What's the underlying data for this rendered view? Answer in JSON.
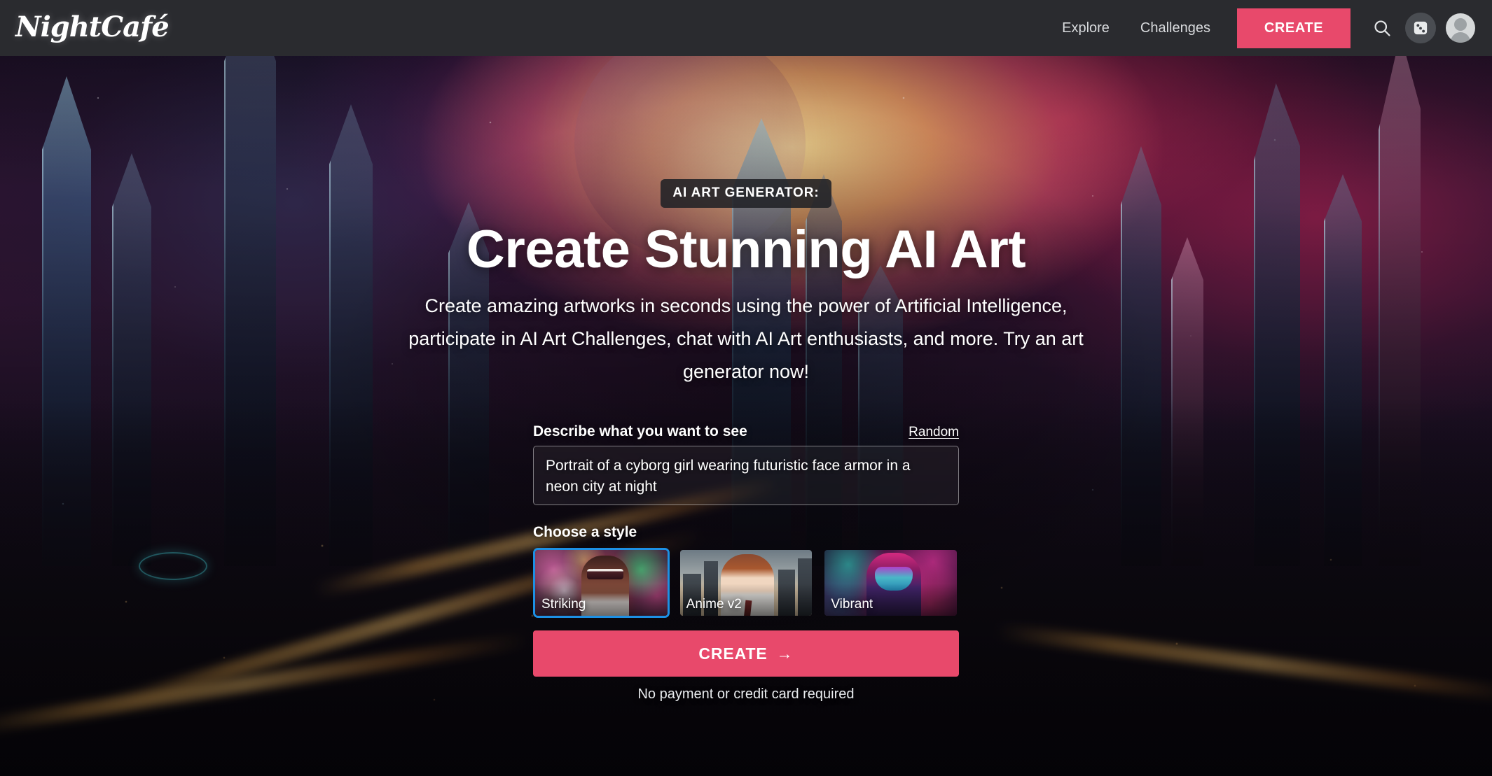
{
  "header": {
    "logo_text": "NightCafé",
    "nav_links": [
      {
        "label": "Explore"
      },
      {
        "label": "Challenges"
      }
    ],
    "create_button_label": "CREATE",
    "icons": {
      "search": "search-icon",
      "dice": "dice-icon",
      "avatar": "avatar-icon"
    }
  },
  "hero": {
    "eyebrow": "AI ART GENERATOR:",
    "headline": "Create Stunning AI Art",
    "subheadline": "Create amazing artworks in seconds using the power of Artificial Intelligence, participate in AI Art Challenges, chat with AI Art enthusiasts, and more. Try an art generator now!"
  },
  "form": {
    "prompt_label": "Describe what you want to see",
    "random_link": "Random",
    "prompt_value": "Portrait of a cyborg girl wearing futuristic face armor in a neon city at night",
    "prompt_placeholder": "Describe what you want to see",
    "style_label": "Choose a style",
    "styles": [
      {
        "name": "Striking",
        "selected": true
      },
      {
        "name": "Anime v2",
        "selected": false
      },
      {
        "name": "Vibrant",
        "selected": false
      }
    ],
    "submit_label": "CREATE",
    "submit_arrow": "→",
    "footnote": "No payment or credit card required"
  },
  "colors": {
    "accent_pink": "#e8496b",
    "header_bg": "#2a2b2f",
    "selected_border": "#1d90e4",
    "text_white": "#ffffff"
  }
}
